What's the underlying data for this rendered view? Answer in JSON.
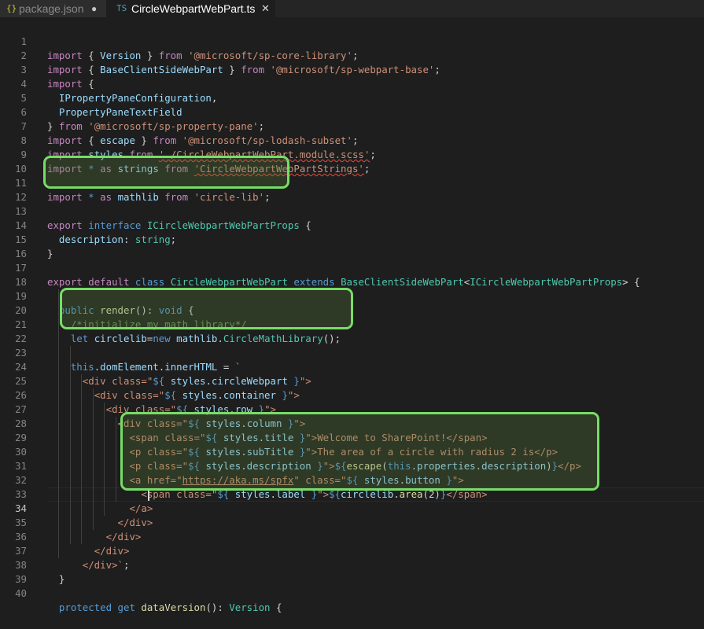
{
  "tabs": [
    {
      "icon": "{}",
      "label": "package.json",
      "modified": "●"
    },
    {
      "icon": "TS",
      "label": "CircleWebpartWebPart.ts",
      "close": "✕"
    }
  ],
  "line_numbers": [
    "1",
    "2",
    "3",
    "4",
    "5",
    "6",
    "7",
    "8",
    "9",
    "10",
    "11",
    "12",
    "13",
    "14",
    "15",
    "16",
    "17",
    "18",
    "19",
    "20",
    "21",
    "22",
    "23",
    "24",
    "25",
    "26",
    "27",
    "28",
    "29",
    "30",
    "31",
    "32",
    "33",
    "34",
    "35",
    "36",
    "37",
    "38",
    "39",
    "40"
  ],
  "code": {
    "l1": [
      "import",
      " { ",
      "Version",
      " } ",
      "from",
      " ",
      "'@microsoft/sp-core-library'",
      ";"
    ],
    "l2": [
      "import",
      " { ",
      "BaseClientSideWebPart",
      " } ",
      "from",
      " ",
      "'@microsoft/sp-webpart-base'",
      ";"
    ],
    "l3": [
      "import",
      " {"
    ],
    "l4": [
      "  ",
      "IPropertyPaneConfiguration",
      ","
    ],
    "l5": [
      "  ",
      "PropertyPaneTextField"
    ],
    "l6": [
      "} ",
      "from",
      " ",
      "'@microsoft/sp-property-pane'",
      ";"
    ],
    "l7": [
      "import",
      " { ",
      "escape",
      " } ",
      "from",
      " ",
      "'@microsoft/sp-lodash-subset'",
      ";"
    ],
    "l8": [
      "import",
      " ",
      "styles",
      " ",
      "from",
      " ",
      "'./CircleWebpartWebPart.module.scss'",
      ";"
    ],
    "l9": [
      "import",
      " ",
      "*",
      " ",
      "as",
      " ",
      "strings",
      " ",
      "from",
      " ",
      "'CircleWebpartWebPartStrings'",
      ";"
    ],
    "l11": [
      "import",
      " ",
      "*",
      " ",
      "as",
      " ",
      "mathlib",
      " ",
      "from",
      " ",
      "'circle-lib'",
      ";"
    ],
    "l13": [
      "export",
      " ",
      "interface",
      " ",
      "ICircleWebpartWebPartProps",
      " {"
    ],
    "l14": [
      "  ",
      "description",
      ": ",
      "string",
      ";"
    ],
    "l15": [
      "}"
    ],
    "l17": [
      "export",
      " ",
      "default",
      " ",
      "class",
      " ",
      "CircleWebpartWebPart",
      " ",
      "extends",
      " ",
      "BaseClientSideWebPart",
      "<",
      "ICircleWebpartWebPartProps",
      "> {"
    ],
    "l19": [
      "  ",
      "public",
      " ",
      "render",
      "(): ",
      "void",
      " {"
    ],
    "l20": [
      "    ",
      "/*initialize my math library*/"
    ],
    "l21": [
      "    ",
      "let",
      " ",
      "circlelib",
      "=",
      "new",
      " ",
      "mathlib",
      ".",
      "CircleMathLibrary",
      "();"
    ],
    "l23": [
      "    ",
      "this",
      ".",
      "domElement",
      ".",
      "innerHTML",
      " = ",
      "`"
    ],
    "l24": [
      "      ",
      "<div class=\"",
      "${ ",
      "styles",
      ".",
      "circleWebpart",
      " }",
      "\">"
    ],
    "l25": [
      "        ",
      "<div class=\"",
      "${ ",
      "styles",
      ".",
      "container",
      " }",
      "\">"
    ],
    "l26": [
      "          ",
      "<div class=\"",
      "${ ",
      "styles",
      ".",
      "row",
      " }",
      "\">"
    ],
    "l27": [
      "            ",
      "<div class=\"",
      "${ ",
      "styles",
      ".",
      "column",
      " }",
      "\">"
    ],
    "l28": [
      "              ",
      "<span class=\"",
      "${ ",
      "styles",
      ".",
      "title",
      " }",
      "\">Welcome to SharePoint!</span>"
    ],
    "l29": [
      "              ",
      "<p class=\"",
      "${ ",
      "styles",
      ".",
      "subTitle",
      " }",
      "\">The area of a circle with radius 2 is</p>"
    ],
    "l30": [
      "              ",
      "<p class=\"",
      "${ ",
      "styles",
      ".",
      "description",
      " }",
      "\">",
      "${",
      "escape",
      "(",
      "this",
      ".",
      "properties",
      ".",
      "description",
      ")",
      "}",
      "</p>"
    ],
    "l31": [
      "              ",
      "<a href=\"",
      "https://aka.ms/spfx",
      "\" class=\"",
      "${ ",
      "styles",
      ".",
      "button",
      " }",
      "\">"
    ],
    "l32": [
      "                ",
      "<span class=\"",
      "${ ",
      "styles",
      ".",
      "label",
      " }",
      "\">",
      "${",
      "circlelib",
      ".",
      "area",
      "(2)",
      "}",
      "</span>"
    ],
    "l33": [
      "              ",
      "</a>"
    ],
    "l34": [
      "            ",
      "</div>"
    ],
    "l35": [
      "          ",
      "</div>"
    ],
    "l36": [
      "        ",
      "</div>"
    ],
    "l37": [
      "      ",
      "</div>`",
      ";"
    ],
    "l38": [
      "  ",
      "}"
    ],
    "l40": [
      "  ",
      "protected",
      " ",
      "get",
      " ",
      "dataVersion",
      "(): ",
      "Version",
      " {"
    ]
  },
  "colors": {
    "background": "#1e1e1e",
    "highlight_border": "#77dd66",
    "keyword": "#569cd6",
    "import_keyword": "#c586c0",
    "string": "#ce9178",
    "type": "#4ec9b0",
    "variable": "#9cdcfe",
    "function": "#dcdcaa",
    "comment": "#6a9955"
  },
  "cursor_line": "34"
}
